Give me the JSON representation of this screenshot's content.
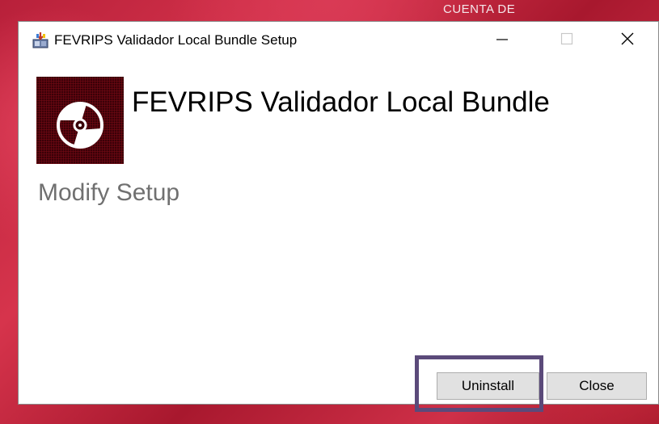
{
  "desktop": {
    "label": "CUENTA DE"
  },
  "window": {
    "title": "FEVRIPS Validador Local Bundle Setup",
    "controls": {
      "minimize_icon": "minimize-icon",
      "maximize_icon": "maximize-icon",
      "close_icon": "close-icon"
    }
  },
  "main": {
    "product_icon": "disc-icon",
    "product_title": "FEVRIPS Validador Local Bundle",
    "subtitle": "Modify Setup"
  },
  "buttons": {
    "uninstall_label": "Uninstall",
    "close_label": "Close"
  },
  "colors": {
    "highlight": "#5b4a7a",
    "subtitle_gray": "#707070",
    "icon_background": "#3a0008"
  }
}
